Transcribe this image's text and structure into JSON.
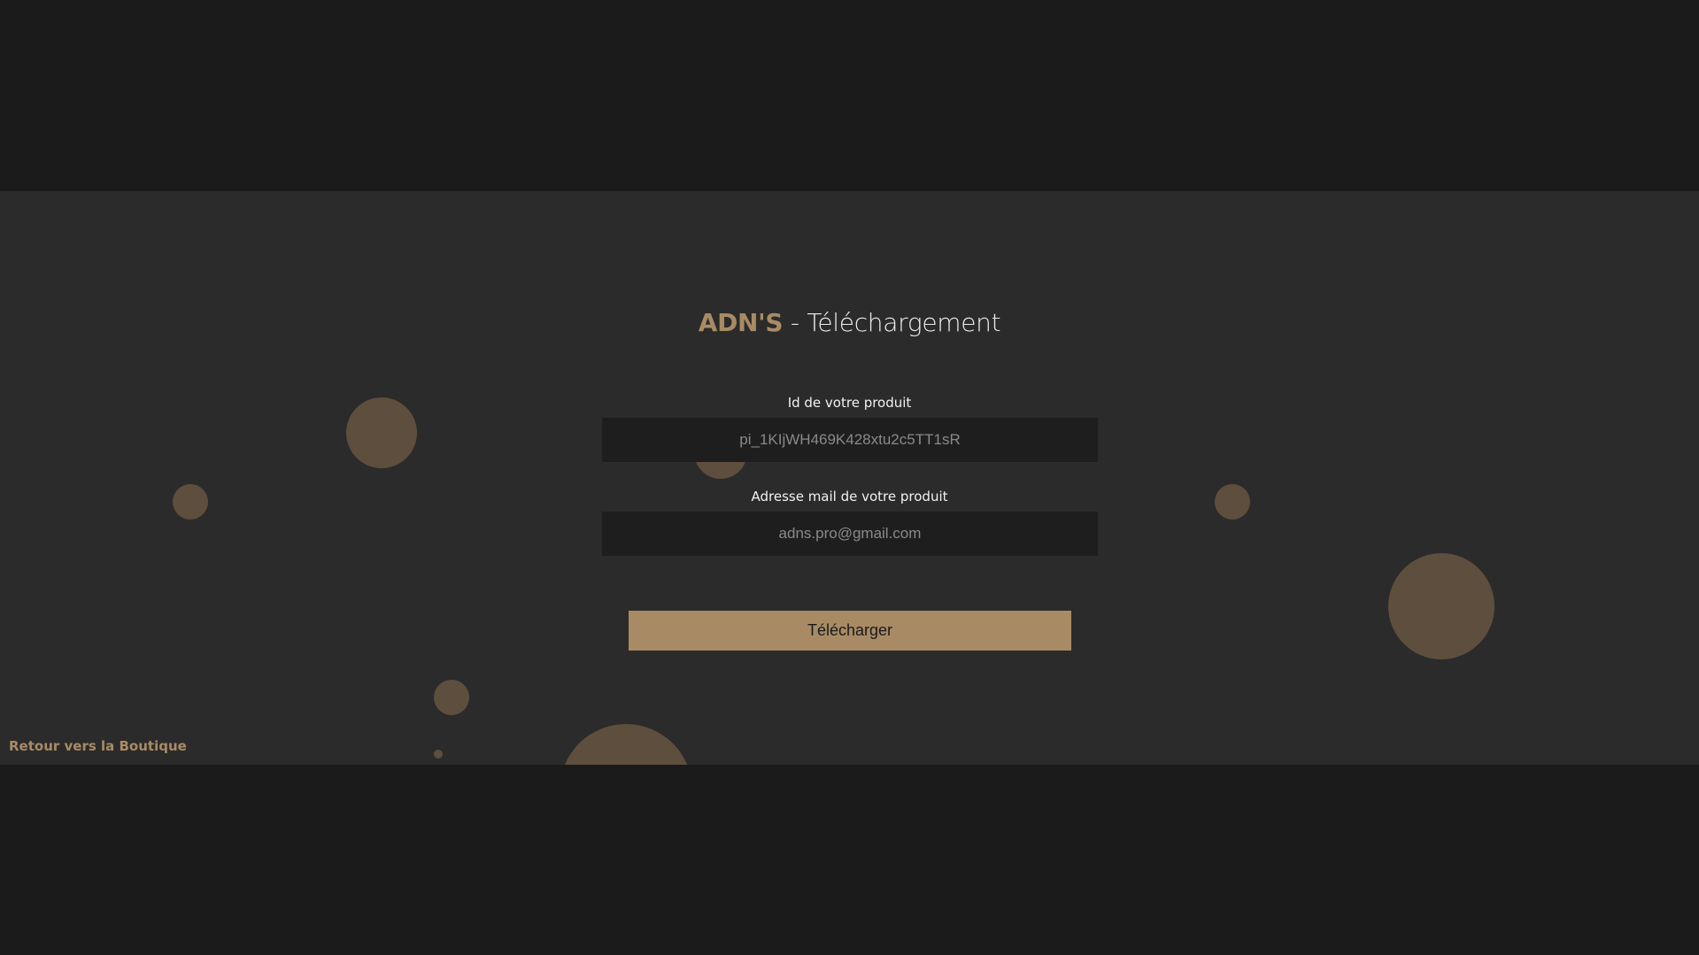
{
  "page": {
    "brand": "ADN'S",
    "title_separator": " - ",
    "title_suffix": "Téléchargement"
  },
  "form": {
    "product_id_label": "Id de votre produit",
    "product_id_value": "pi_1KIjWH469K428xtu2c5TT1sR",
    "email_label": "Adresse mail de votre produit",
    "email_value": "adns.pro@gmail.com",
    "submit_label": "Télécharger"
  },
  "footer": {
    "back_link_label": "Retour vers la Boutique"
  },
  "colors": {
    "background": "#1b1b1b",
    "panel": "#2b2b2b",
    "accent": "#a88b65",
    "bubble": "#5e4e3d",
    "input_bg": "#1e1e1e"
  }
}
